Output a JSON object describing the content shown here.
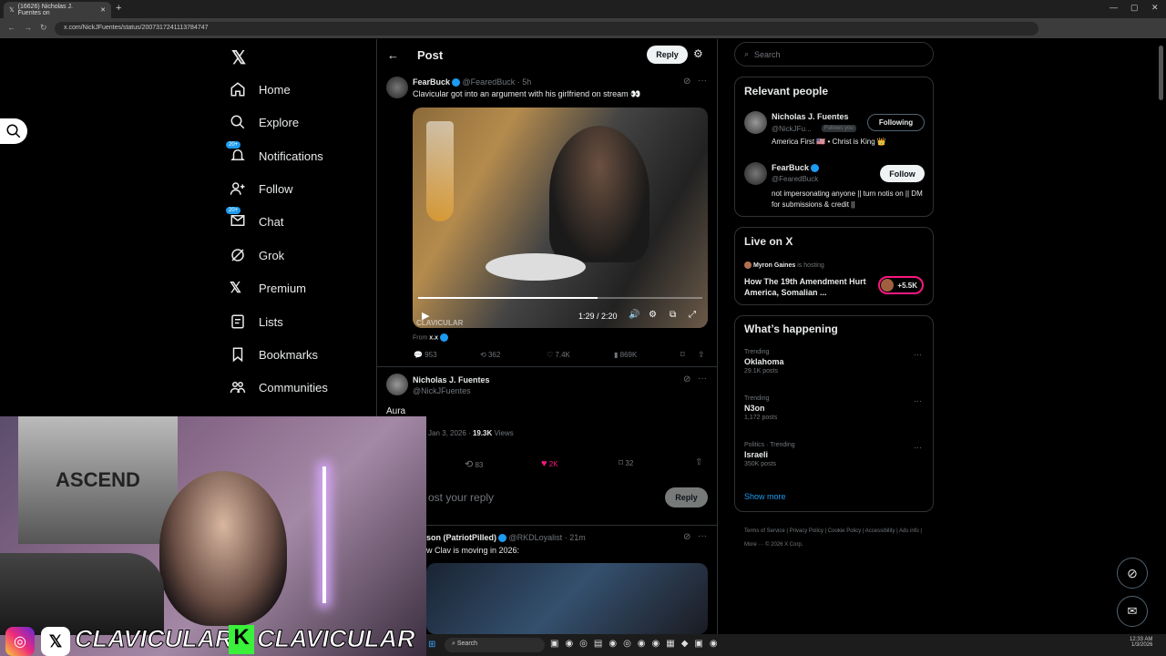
{
  "browser": {
    "tab_title": "(16626) Nicholas J. Fuentes on",
    "url": "x.com/NickJFuentes/status/2007317241113784747"
  },
  "nav": {
    "items": [
      {
        "label": "Home"
      },
      {
        "label": "Explore"
      },
      {
        "label": "Notifications",
        "badge": "20+"
      },
      {
        "label": "Follow"
      },
      {
        "label": "Chat",
        "badge": "20+"
      },
      {
        "label": "Grok"
      },
      {
        "label": "Premium"
      },
      {
        "label": "Lists"
      },
      {
        "label": "Bookmarks"
      },
      {
        "label": "Communities"
      }
    ]
  },
  "header": {
    "title": "Post",
    "reply_button": "Reply"
  },
  "quoted_post": {
    "author": "FearBuck",
    "handle": "@FearedBuck",
    "time": "· 5h",
    "text": "Clavicular got into an argument with his girlfriend on stream 👀",
    "video_time": "1:29 / 2:20",
    "video_progress": 0.63,
    "from_label": "From",
    "from_handle": "x.x",
    "replies": "953",
    "reposts": "362",
    "likes": "7.4K",
    "views": "869K"
  },
  "main_post": {
    "author": "Nicholas J. Fuentes",
    "handle": "@NickJFuentes",
    "text": "Aura",
    "date": "Jan 3, 2026 ·",
    "views": "19.3K",
    "views_label": "Views",
    "reposts": "83",
    "likes": "2K",
    "bookmarks": "32"
  },
  "reply_box": {
    "placeholder": "ost your reply",
    "button": "Reply"
  },
  "reply_post": {
    "author": "son (PatriotPilled)",
    "handle": "@RKDLoyalist",
    "time": "· 21m",
    "text": "w Clav is moving in 2026:"
  },
  "search": {
    "placeholder": "Search"
  },
  "relevant": {
    "title": "Relevant people",
    "people": [
      {
        "name": "Nicholas J. Fuentes",
        "handle": "@NickJFu...",
        "follows_you": "Follows you",
        "button": "Following",
        "bio": "America First 🇺🇸 • Christ is King 👑"
      },
      {
        "name": "FearBuck",
        "handle": "@FearedBuck",
        "button": "Follow",
        "bio": "not impersonating anyone || turn notis on || DM for submissions & credit ||"
      }
    ]
  },
  "live": {
    "title": "Live on X",
    "host": "Myron Gaines",
    "host_suffix": "is hosting",
    "space_title": "How The 19th Amendment Hurt America, Somalian ...",
    "listeners": "+5.5K"
  },
  "happening": {
    "title": "What’s happening",
    "trends": [
      {
        "category": "Trending",
        "name": "Oklahoma",
        "count": "29.1K posts"
      },
      {
        "category": "Trending",
        "name": "N3on",
        "count": "1,172 posts"
      },
      {
        "category": "Politics · Trending",
        "name": "Israeli",
        "count": "350K posts"
      }
    ],
    "show_more": "Show more"
  },
  "footer": {
    "links": [
      "Terms of Service",
      "Privacy Policy",
      "Cookie Policy",
      "Accessibility",
      "Ads info",
      "More ···",
      "© 2026 X Corp."
    ]
  },
  "overlay": {
    "banner": "CLAVICULARO",
    "banner2": "CLAVICULAR",
    "poster_text": "ASCEND",
    "watermark": "CLAVICULAR"
  },
  "taskbar": {
    "search": "Search",
    "time": "12:33 AM",
    "date": "1/3/2026"
  }
}
